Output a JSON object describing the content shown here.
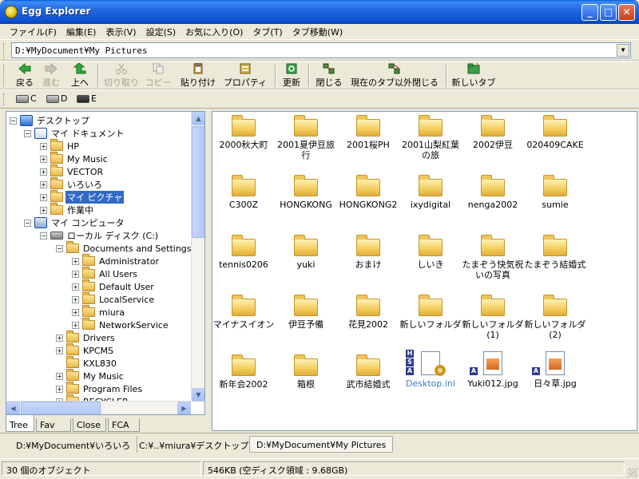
{
  "window": {
    "title": "Egg Explorer"
  },
  "menu": [
    "ファイル(F)",
    "編集(E)",
    "表示(V)",
    "設定(S)",
    "お気に入り(O)",
    "タブ(T)",
    "タブ移動(W)"
  ],
  "address": {
    "value": "D:¥MyDocument¥My Pictures"
  },
  "toolbar": {
    "back": "戻る",
    "forward": "進む",
    "up": "上へ",
    "cut": "切り取り",
    "copy": "コピー",
    "paste": "貼り付け",
    "properties": "プロパティ",
    "refresh": "更新",
    "close": "閉じる",
    "close_others": "現在のタブ以外閉じる",
    "new_tab": "新しいタブ"
  },
  "drives": [
    "C",
    "D",
    "E"
  ],
  "tree": {
    "desktop": "デスクトップ",
    "my_documents": "マイ ドキュメント",
    "docs": [
      "HP",
      "My Music",
      "VECTOR",
      "いろいろ",
      "マイ ピクチャ",
      "作業中"
    ],
    "my_computer": "マイ コンピュータ",
    "local_disk": "ローカル ディスク (C:)",
    "docs_settings": "Documents and Settings",
    "users": [
      "Administrator",
      "All Users",
      "Default User",
      "LocalService",
      "miura",
      "NetworkService"
    ],
    "c_folders": [
      "Drivers",
      "KPCMS",
      "KXL830",
      "My Music",
      "Program Files",
      "RECYCLER"
    ]
  },
  "tree_tabs": [
    "Tree",
    "Fav",
    "Close",
    "FCA"
  ],
  "files": [
    "2000秋大町",
    "2001夏伊豆旅行",
    "2001桜PH",
    "2001山梨紅葉の旅",
    "2002伊豆",
    "020409CAKE",
    "C300Z",
    "HONGKONG",
    "HONGKONG2",
    "ixydigital",
    "nenga2002",
    "sumie",
    "tennis0206",
    "yuki",
    "おまけ",
    "しいき",
    "たまぞう快気祝いの写真",
    "たまぞう結婚式",
    "マイナスイオン",
    "伊豆予備",
    "花見2002",
    "新しいフォルダ",
    "新しいフォルダ (1)",
    "新しいフォルダ (2)",
    "新年会2002",
    "箱根",
    "武市結婚式",
    "Desktop.ini",
    "Yuki012.jpg",
    "日々草.jpg"
  ],
  "doc_tabs": [
    "D:¥MyDocument¥いろいろ",
    "C:¥..¥miura¥デスクトップ",
    "D:¥MyDocument¥My Pictures"
  ],
  "status": {
    "count": "30 個のオブジェクト",
    "size": "546KB (空ディスク領域 : 9.68GB)"
  }
}
